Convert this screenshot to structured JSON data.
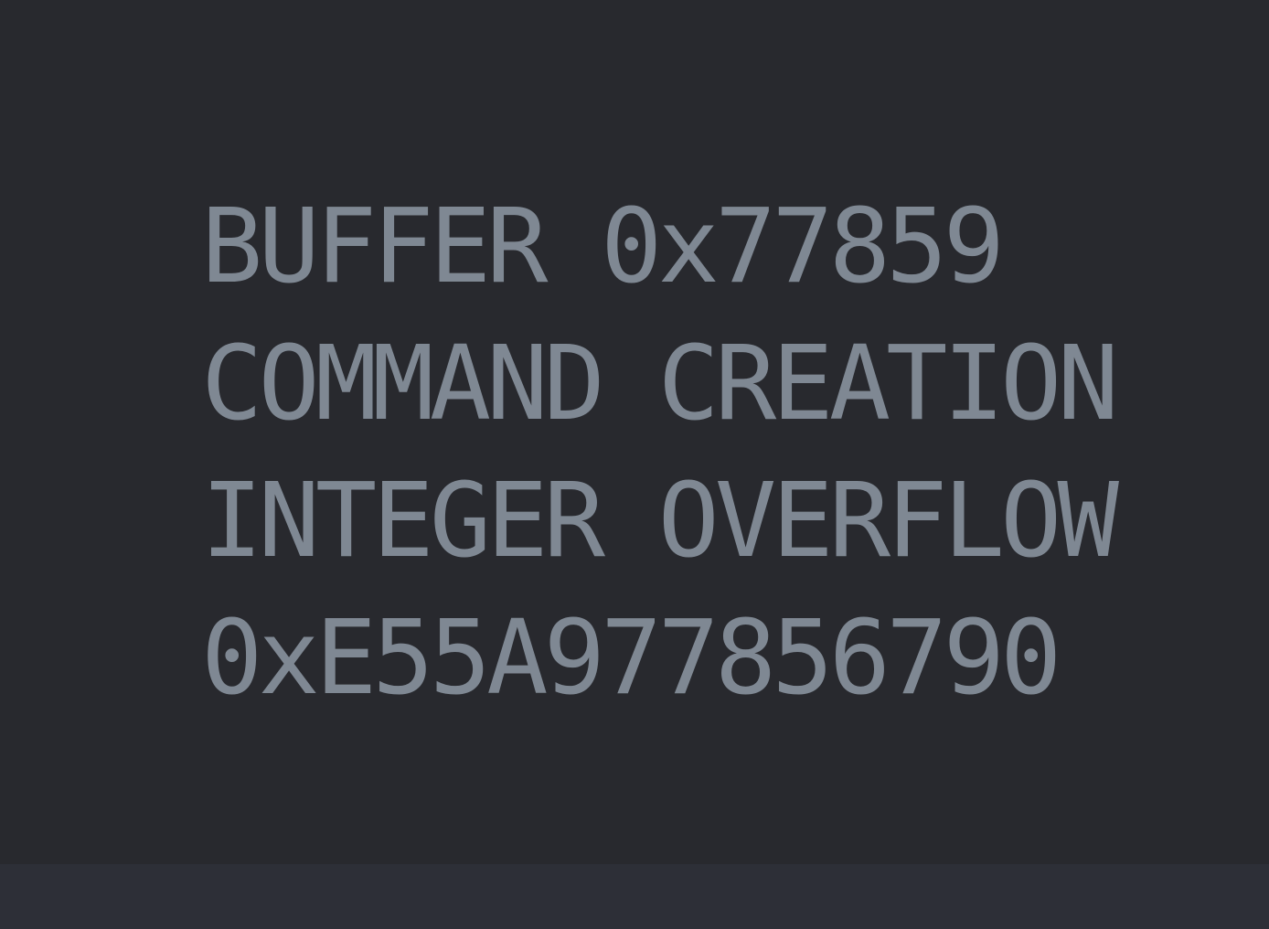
{
  "error_message": {
    "lines": [
      "BUFFER 0x77859",
      "COMMAND CREATION",
      "INTEGER OVERFLOW",
      "0xE55A977856790"
    ]
  },
  "colors": {
    "background": "#28292e",
    "text": "#7f8893",
    "bottom_bar": "#2d2f37"
  }
}
